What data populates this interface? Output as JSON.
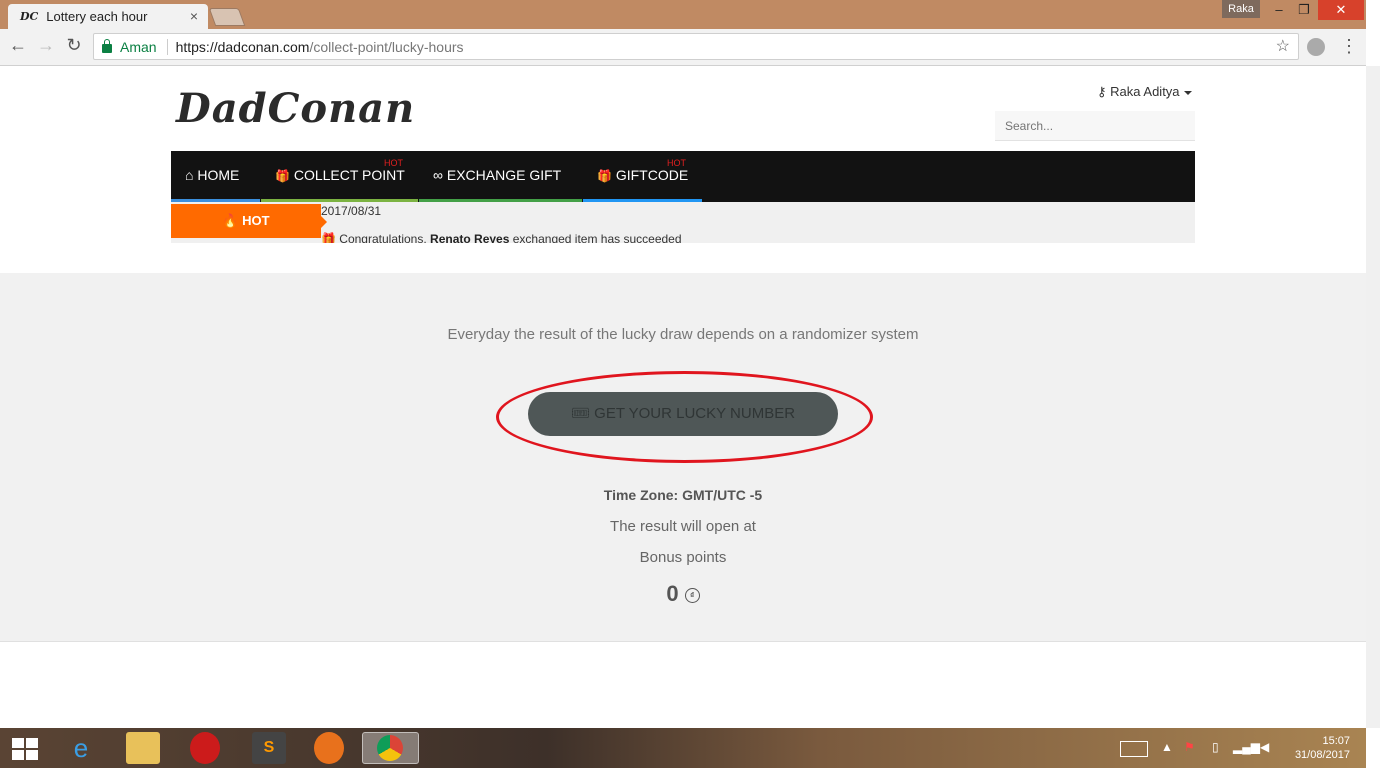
{
  "browser": {
    "tab_title": "Lottery each hour",
    "tab_favicon": "DC",
    "tab_close": "×",
    "profile_name": "Raka",
    "window_minimize": "–",
    "window_restore": "❐",
    "window_close": "✕",
    "security_label": "Aman",
    "url_host": "https://dadconan.com",
    "url_path": "/collect-point/lucky-hours",
    "back": "←",
    "forward": "→",
    "reload": "↻",
    "star": "☆",
    "menu": "⋮"
  },
  "header": {
    "logo": "DadConan",
    "user_name": "Raka Aditya",
    "search_placeholder": "Search..."
  },
  "nav": {
    "items": [
      {
        "label": "HOME",
        "icon": "⌂",
        "underline": "#3b8fdd",
        "hot": ""
      },
      {
        "label": "COLLECT POINT",
        "icon": "🎁",
        "underline": "#7cb342",
        "hot": "HOT"
      },
      {
        "label": "EXCHANGE GIFT",
        "icon": "∞",
        "underline": "#43a047",
        "hot": ""
      },
      {
        "label": "GIFTCODE",
        "icon": "🎁",
        "underline": "#2196f3",
        "hot": "HOT"
      }
    ]
  },
  "ticker": {
    "hot_label": "HOT",
    "date": "2017/08/31",
    "message_prefix": "Congratulations",
    "message_name": "Renato Reyes",
    "message_suffix": "exchanged item has succeeded"
  },
  "lucky": {
    "intro": "Everyday the result of the lucky draw depends on a randomizer system",
    "button_label": "GET YOUR LUCKY NUMBER",
    "timezone": "Time Zone: GMT/UTC -5",
    "opens": "The result will open at",
    "bonus_label": "Bonus points",
    "points": "0",
    "coin_symbol": "₫"
  },
  "taskbar": {
    "time": "15:07",
    "date": "31/08/2017"
  }
}
